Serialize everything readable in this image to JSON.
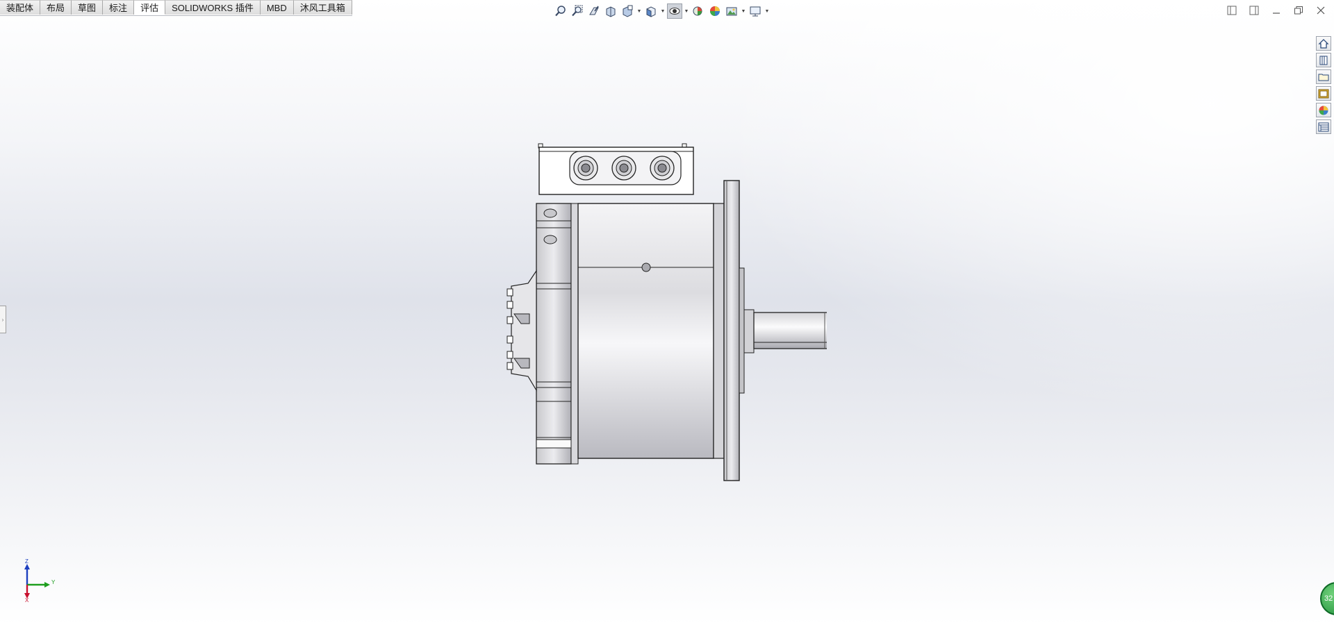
{
  "tabs": [
    {
      "label": "装配体",
      "active": false
    },
    {
      "label": "布局",
      "active": false
    },
    {
      "label": "草图",
      "active": false
    },
    {
      "label": "标注",
      "active": false
    },
    {
      "label": "评估",
      "active": true
    },
    {
      "label": "SOLIDWORKS 插件",
      "active": false
    },
    {
      "label": "MBD",
      "active": false
    },
    {
      "label": "沐风工具箱",
      "active": false
    }
  ],
  "heads_up_toolbar": [
    "zoom-to-fit-icon",
    "zoom-to-area-icon",
    "previous-view-icon",
    "section-view-icon",
    "dynamic-annotation-view-icon",
    "view-orientation-icon",
    "display-style-icon",
    "hide-show-items-icon",
    "edit-appearance-icon",
    "apply-scene-icon",
    "view-settings-icon"
  ],
  "task_pane": [
    "solidworks-resources-icon",
    "design-library-icon",
    "file-explorer-icon",
    "view-palette-icon",
    "appearances-scenes-icon",
    "custom-properties-icon"
  ],
  "triad": {
    "z": "Z",
    "y": "Y",
    "x": "X"
  },
  "badge": {
    "label": "32"
  },
  "colors": {
    "accent_green": "#1f8f3a",
    "axis_x": "#c8102e",
    "axis_y": "#1e9e1e",
    "axis_z": "#1d3fbf"
  }
}
